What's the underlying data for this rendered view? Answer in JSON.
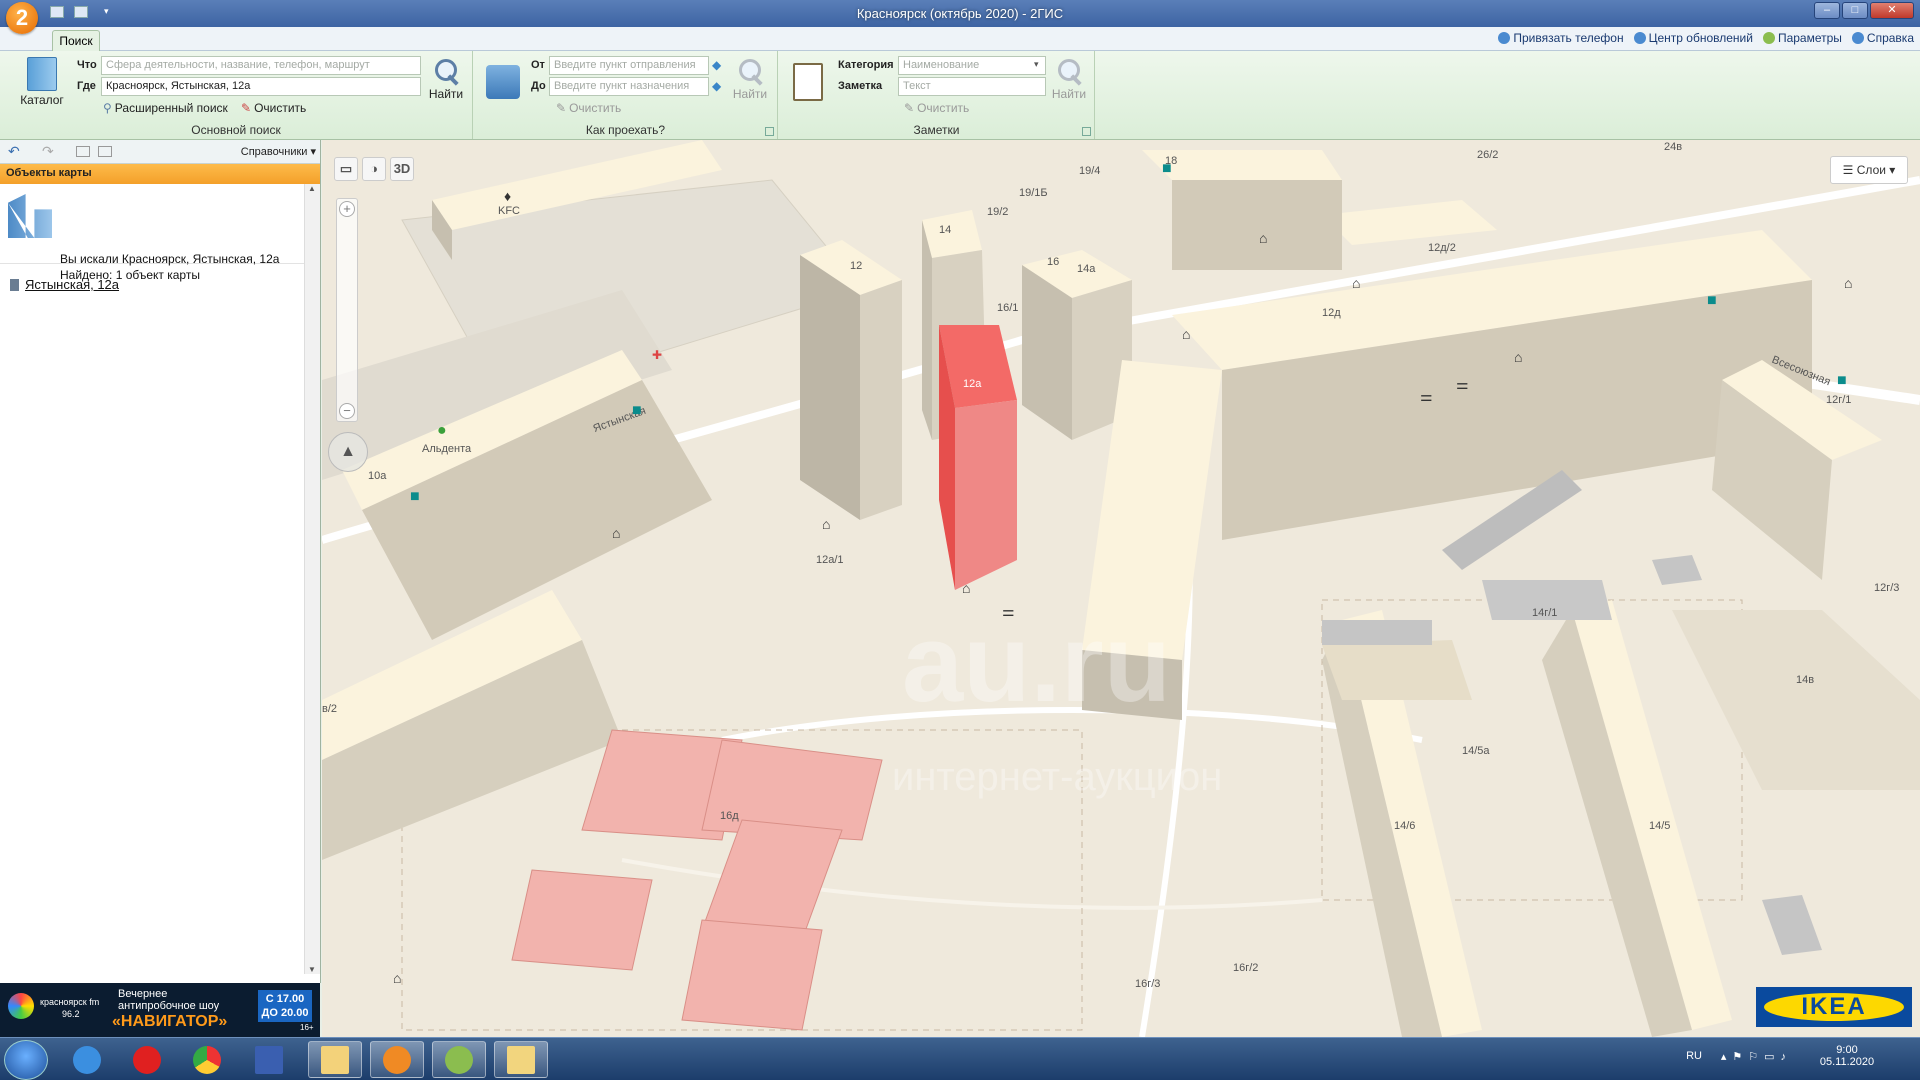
{
  "window": {
    "title": "Красноярск (октябрь 2020) - 2ГИС",
    "logo_text": "2",
    "controls": {
      "minimize": "–",
      "maximize": "□",
      "close": "✕"
    }
  },
  "menubar": {
    "tab_search": "Поиск",
    "bind_phone": "Привязать телефон",
    "update_center": "Центр обновлений",
    "params": "Параметры",
    "help": "Справка"
  },
  "ribbon": {
    "catalog": "Каталог",
    "what_label": "Что",
    "what_placeholder": "Сфера деятельности, название, телефон, маршрут",
    "where_label": "Где",
    "where_value": "Красноярск, Ястынская, 12а",
    "find": "Найти",
    "advanced_search": "Расширенный поиск",
    "clear": "Очистить",
    "group_main": "Основной поиск",
    "from_label": "От",
    "from_placeholder": "Введите пункт отправления",
    "to_label": "До",
    "to_placeholder": "Введите пункт назначения",
    "route_find": "Найти",
    "route_clear": "Очистить",
    "group_route": "Как проехать?",
    "category_label": "Категория",
    "category_placeholder": "Наименование",
    "note_label": "Заметка",
    "note_placeholder": "Текст",
    "notes_find": "Найти",
    "notes_clear": "Очистить",
    "group_notes": "Заметки"
  },
  "sidebar": {
    "directories": "Справочники",
    "header": "Объекты карты",
    "searched": "Вы искали Красноярск, Ястынская, 12а",
    "found": "Найдено: 1 объект карты",
    "result_item": "Ястынская, 12а"
  },
  "ad": {
    "station": "красноярск fm",
    "freq": "96.2",
    "line1": "Вечернее",
    "line2": "антипробочное шоу",
    "show": "«НАВИГАТОР»",
    "time1": "С 17.00",
    "time2": "ДО 20.00",
    "age": "16+"
  },
  "map": {
    "tool_3d": "3D",
    "layers": "Слои",
    "ikea": "IKEA",
    "watermark": "au.ru",
    "watermark_sub": "интернет-аукцион",
    "labels": {
      "kfc": "KFC",
      "aldenta": "Альдента",
      "b10a": "10а",
      "b12": "12",
      "b14": "14",
      "b14a": "14а",
      "b16": "16",
      "b16_1": "16/1",
      "b19_2": "19/2",
      "b19_1b": "19/1Б",
      "b19_4": "19/4",
      "b18": "18",
      "b26_2": "26/2",
      "b24v": "24в",
      "b12d2": "12д/2",
      "b12d": "12д",
      "b12a": "12а",
      "b12a1": "12а/1",
      "b12r1": "12г/1",
      "b12r3": "12г/3",
      "b14r1": "14г/1",
      "b14v": "14в",
      "b14_5a": "14/5а",
      "b14_6": "14/6",
      "b14_5": "14/5",
      "b16d": "16д",
      "b16r3": "16г/3",
      "b16r2": "16г/2",
      "b8_2": "в/2",
      "street1": "Ястынская",
      "street2": "Всесоюзная"
    }
  },
  "taskbar": {
    "lang": "RU",
    "time": "9:00",
    "date": "05.11.2020"
  }
}
